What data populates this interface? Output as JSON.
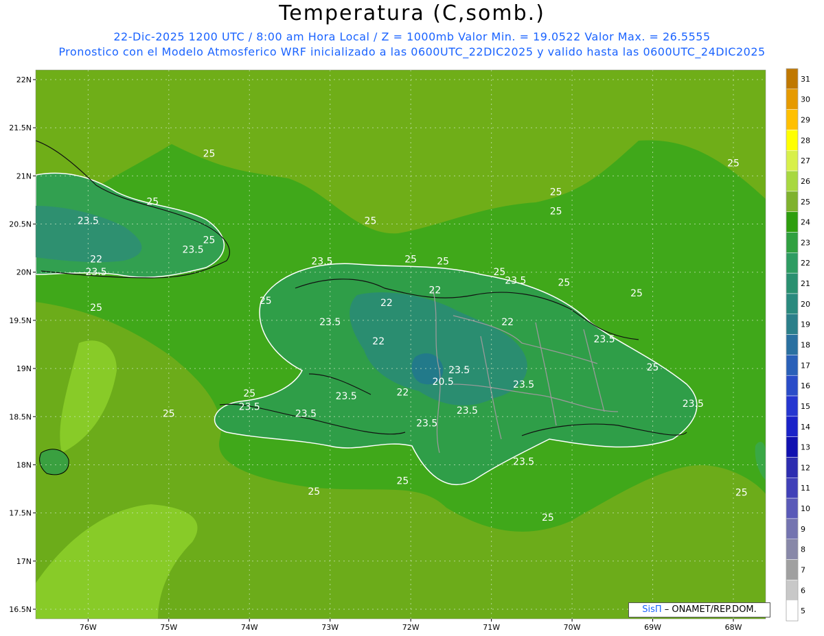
{
  "header": {
    "title": "Temperatura (C,somb.)",
    "line1": "22-Dic-2025  1200 UTC / 8:00 am Hora Local / Z = 1000mb   Valor Min. = 19.0522  Valor Max. = 26.5555",
    "line2": "Pronostico con el Modelo Atmosferico WRF inicializado a las 0600UTC_22DIC2025 y valido hasta las  0600UTC_24DIC2025"
  },
  "axes": {
    "lat_labels": [
      "22N",
      "21.5N",
      "21N",
      "20.5N",
      "20N",
      "19.5N",
      "19N",
      "18.5N",
      "18N",
      "17.5N",
      "17N",
      "16.5N"
    ],
    "lat_values": [
      22,
      21.5,
      21,
      20.5,
      20,
      19.5,
      19,
      18.5,
      18,
      17.5,
      17,
      16.5
    ],
    "lon_labels": [
      "76W",
      "75W",
      "74W",
      "73W",
      "72W",
      "71W",
      "70W",
      "69W",
      "68W"
    ],
    "lon_values": [
      -76,
      -75,
      -74,
      -73,
      -72,
      -71,
      -70,
      -69,
      -68
    ]
  },
  "colorbar": {
    "labels": [
      "31",
      "30",
      "29",
      "28",
      "27",
      "26",
      "25",
      "24",
      "23",
      "22",
      "21",
      "20",
      "19",
      "18",
      "17",
      "16",
      "15",
      "14",
      "13",
      "12",
      "11",
      "10",
      "9",
      "8",
      "7",
      "6",
      "5"
    ],
    "colors": [
      "#c07800",
      "#e69a00",
      "#ffc000",
      "#ffff00",
      "#d8f04a",
      "#a8d840",
      "#7fb22e",
      "#2e9e0e",
      "#30a040",
      "#2e9c62",
      "#2a9070",
      "#2a8a7e",
      "#2b7f8a",
      "#2a70a0",
      "#2a60b8",
      "#2a4cc8",
      "#2536d0",
      "#1a22c8",
      "#1010b0",
      "#2d2db0",
      "#4040b8",
      "#5a5ab8",
      "#7474b0",
      "#8888a8",
      "#a0a0a0",
      "#c8c8c8",
      "#ffffff"
    ]
  },
  "map": {
    "sea_color": "#40a81a",
    "land_color": "#2e9e3e",
    "contour_labels": [
      {
        "text": "25",
        "lon": -74.5,
        "lat": 21.2
      },
      {
        "text": "25",
        "lon": -75.2,
        "lat": 20.7
      },
      {
        "text": "23.5",
        "lon": -76.0,
        "lat": 20.5
      },
      {
        "text": "25",
        "lon": -74.5,
        "lat": 20.3
      },
      {
        "text": "23.5",
        "lon": -74.7,
        "lat": 20.2
      },
      {
        "text": "22",
        "lon": -75.9,
        "lat": 20.1
      },
      {
        "text": "23.5",
        "lon": -75.9,
        "lat": 19.97
      },
      {
        "text": "25",
        "lon": -75.9,
        "lat": 19.6
      },
      {
        "text": "25",
        "lon": -72.5,
        "lat": 20.5
      },
      {
        "text": "25",
        "lon": -70.2,
        "lat": 20.8
      },
      {
        "text": "25",
        "lon": -70.2,
        "lat": 20.6
      },
      {
        "text": "25",
        "lon": -68.0,
        "lat": 21.1
      },
      {
        "text": "23.5",
        "lon": -73.1,
        "lat": 20.08
      },
      {
        "text": "25",
        "lon": -72.0,
        "lat": 20.1
      },
      {
        "text": "25",
        "lon": -71.6,
        "lat": 20.08
      },
      {
        "text": "25",
        "lon": -73.8,
        "lat": 19.67
      },
      {
        "text": "22",
        "lon": -72.3,
        "lat": 19.65
      },
      {
        "text": "22",
        "lon": -71.7,
        "lat": 19.78
      },
      {
        "text": "25",
        "lon": -70.9,
        "lat": 19.97
      },
      {
        "text": "23.5",
        "lon": -70.7,
        "lat": 19.88
      },
      {
        "text": "25",
        "lon": -70.1,
        "lat": 19.86
      },
      {
        "text": "25",
        "lon": -69.2,
        "lat": 19.75
      },
      {
        "text": "23.5",
        "lon": -73.0,
        "lat": 19.45
      },
      {
        "text": "22",
        "lon": -70.8,
        "lat": 19.45
      },
      {
        "text": "22",
        "lon": -72.4,
        "lat": 19.25
      },
      {
        "text": "23.5",
        "lon": -69.6,
        "lat": 19.27
      },
      {
        "text": "25",
        "lon": -69.0,
        "lat": 18.98
      },
      {
        "text": "23.5",
        "lon": -71.4,
        "lat": 18.95
      },
      {
        "text": "20.5",
        "lon": -71.6,
        "lat": 18.83
      },
      {
        "text": "23.5",
        "lon": -70.6,
        "lat": 18.8
      },
      {
        "text": "25",
        "lon": -74.0,
        "lat": 18.71
      },
      {
        "text": "22",
        "lon": -72.1,
        "lat": 18.72
      },
      {
        "text": "23.5",
        "lon": -72.8,
        "lat": 18.68
      },
      {
        "text": "23.5",
        "lon": -74.0,
        "lat": 18.57
      },
      {
        "text": "25",
        "lon": -75.0,
        "lat": 18.5
      },
      {
        "text": "23.5",
        "lon": -73.3,
        "lat": 18.5
      },
      {
        "text": "23.5",
        "lon": -71.3,
        "lat": 18.53
      },
      {
        "text": "23.5",
        "lon": -71.8,
        "lat": 18.4
      },
      {
        "text": "23.5",
        "lon": -68.5,
        "lat": 18.6
      },
      {
        "text": "23.5",
        "lon": -70.6,
        "lat": 18.0
      },
      {
        "text": "25",
        "lon": -72.1,
        "lat": 17.8
      },
      {
        "text": "25",
        "lon": -73.2,
        "lat": 17.69
      },
      {
        "text": "25",
        "lon": -67.9,
        "lat": 17.68
      },
      {
        "text": "25",
        "lon": -70.3,
        "lat": 17.42
      }
    ]
  },
  "credit": {
    "sis": "SisΠ",
    "rest": " – ONAMET/REP.DOM."
  }
}
